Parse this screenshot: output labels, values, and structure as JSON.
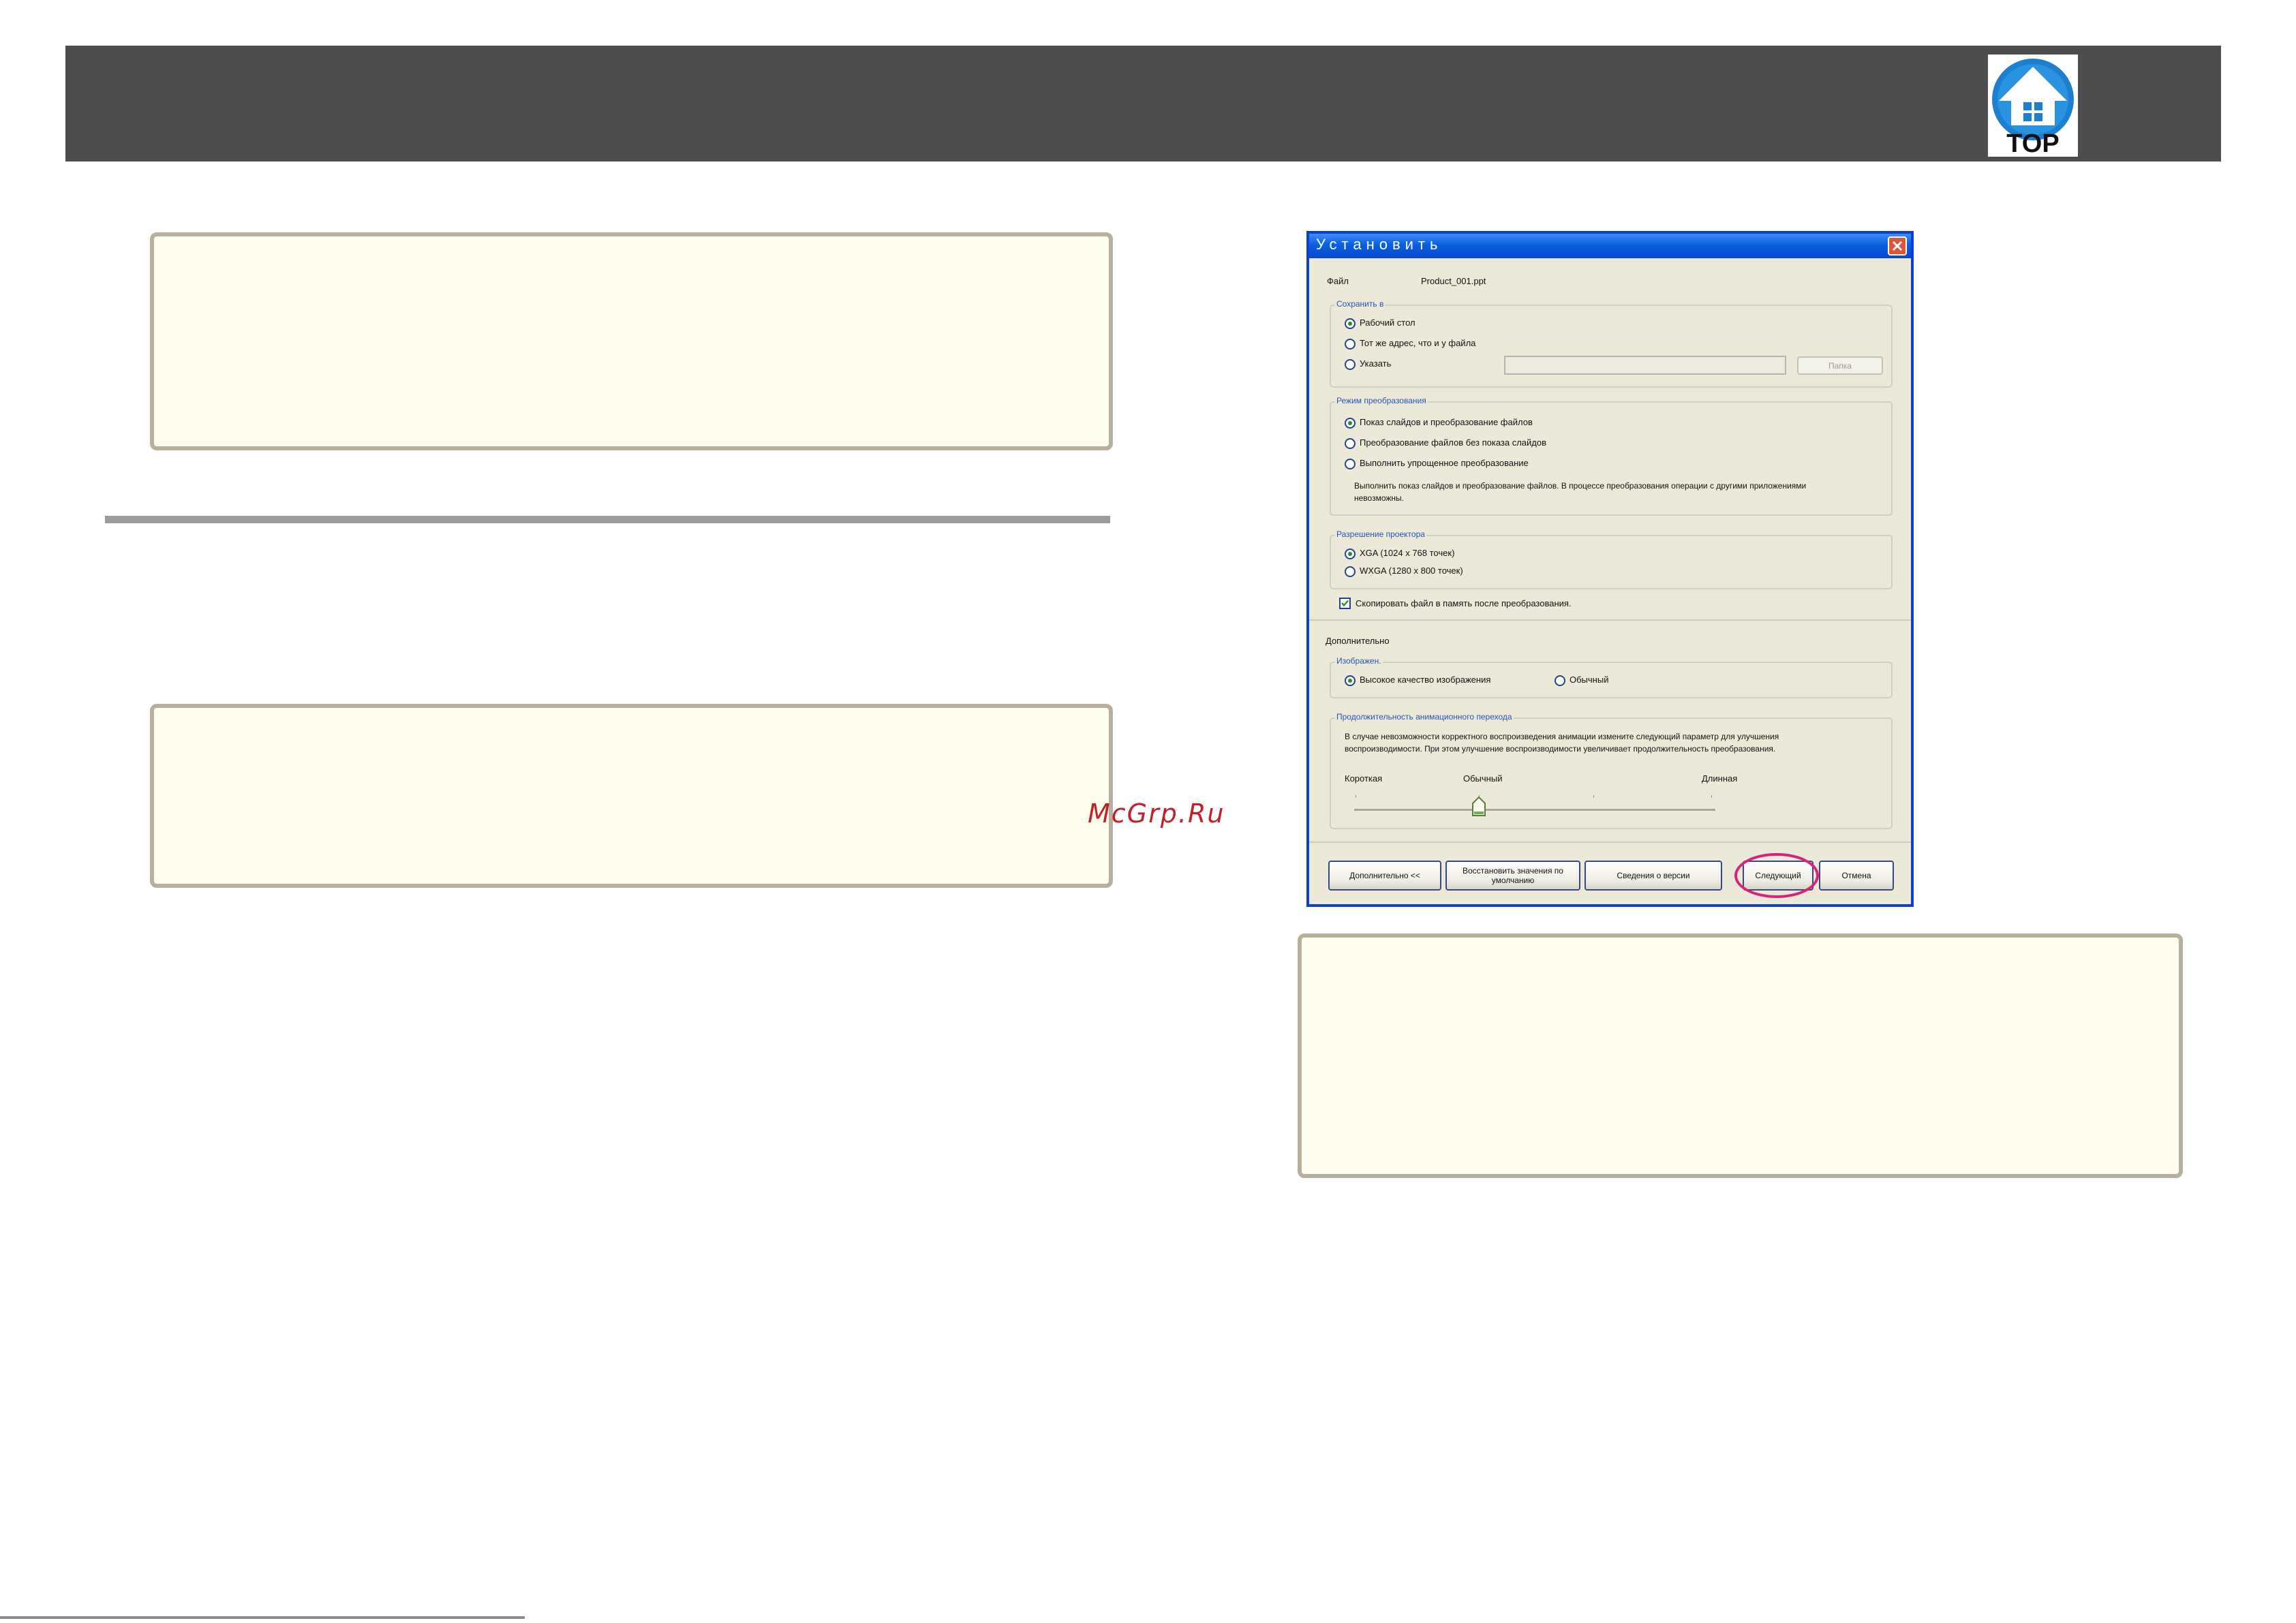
{
  "header": {
    "logo_text": "TOP",
    "logo_icon": "home-house-icon"
  },
  "watermark": "McGrp.Ru",
  "dialog": {
    "title": "Установить",
    "file_label": "Файл",
    "file_name": "Product_001.ppt",
    "save_to": {
      "legend": "Сохранить в",
      "options": [
        "Рабочий стол",
        "Тот же адрес, что и у файла",
        "Указать"
      ],
      "selected": 0,
      "path_value": "",
      "folder_button": "Папка"
    },
    "conversion_mode": {
      "legend": "Режим преобразования",
      "options": [
        "Показ слайдов и преобразование файлов",
        "Преобразование файлов без показа слайдов",
        "Выполнить упрощенное преобразование"
      ],
      "selected": 0,
      "description_line1": "Выполнить показ слайдов и преобразование файлов. В процессе преобразования операции с другими приложениями",
      "description_line2": "невозможны."
    },
    "resolution": {
      "legend": "Разрешение проектора",
      "options": [
        "XGA (1024 x 768 точек)",
        "WXGA (1280 x 800 точек)"
      ],
      "selected": 0
    },
    "copy_checkbox": {
      "label": "Скопировать файл в память после преобразования.",
      "checked": true
    },
    "advanced_heading": "Дополнительно",
    "image": {
      "legend": "Изображен.",
      "options": [
        "Высокое качество изображения",
        "Обычный"
      ],
      "selected": 0
    },
    "animation": {
      "legend": "Продолжительность анимационного перехода",
      "text_line1": "В случае невозможности корректного воспроизведения анимации измените следующий параметр для улучшения",
      "text_line2": "воспроизводимости. При этом улучшение воспроизводимости увеличивает продолжительность преобразования.",
      "label_short": "Короткая",
      "label_normal": "Обычный",
      "label_long": "Длинная",
      "slider_value": 1,
      "slider_steps": 4
    },
    "buttons": {
      "advanced": "Дополнительно <<",
      "restore_defaults": "Восстановить значения по умолчанию",
      "about": "Сведения о версии",
      "next": "Следующий",
      "cancel": "Отмена"
    },
    "colors": {
      "titlebar": "#0a5fe0",
      "highlight": "#d6247a"
    }
  }
}
